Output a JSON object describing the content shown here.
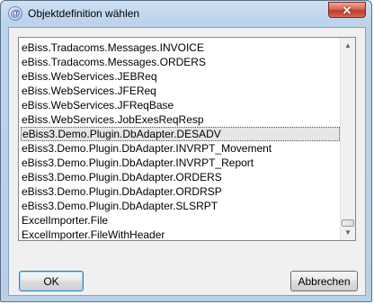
{
  "window": {
    "title": "Objektdefinition wählen",
    "icon": "at-sign-icon",
    "icon_glyph": "@"
  },
  "close_button": {
    "glyph": "✕"
  },
  "list": {
    "selected_index": 6,
    "items": [
      "eBiss.Tradacoms.Messages.INVOICE",
      "eBiss.Tradacoms.Messages.ORDERS",
      "eBiss.WebServices.JEBReq",
      "eBiss.WebServices.JFEReq",
      "eBiss.WebServices.JFReqBase",
      "eBiss.WebServices.JobExesReqResp",
      "eBiss3.Demo.Plugin.DbAdapter.DESADV",
      "eBiss3.Demo.Plugin.DbAdapter.INVRPT_Movement",
      "eBiss3.Demo.Plugin.DbAdapter.INVRPT_Report",
      "eBiss3.Demo.Plugin.DbAdapter.ORDERS",
      "eBiss3.Demo.Plugin.DbAdapter.ORDRSP",
      "eBiss3.Demo.Plugin.DbAdapter.SLSRPT",
      "ExcelImporter.File",
      "ExcelImporter.FileWithHeader"
    ]
  },
  "scrollbar": {
    "up_glyph": "▲",
    "down_glyph": "▼"
  },
  "buttons": {
    "ok": "OK",
    "cancel": "Abbrechen"
  }
}
